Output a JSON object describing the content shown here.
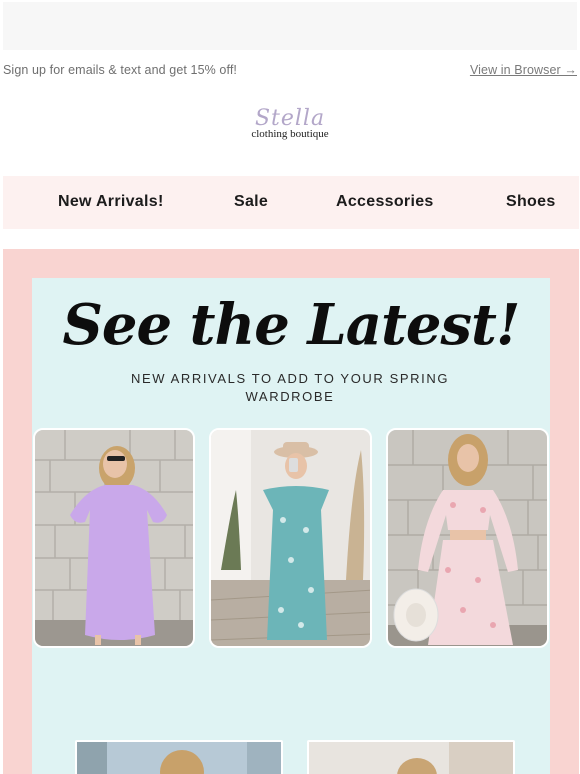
{
  "preheader": {
    "signup_text": "Sign up for emails & text and get 15% off!",
    "view_in_browser": "View in Browser →"
  },
  "logo": {
    "script_text": "Stella",
    "subtitle": "clothing boutique"
  },
  "nav": {
    "items": [
      {
        "label": "New Arrivals!"
      },
      {
        "label": "Sale"
      },
      {
        "label": "Accessories"
      },
      {
        "label": "Shoes"
      }
    ]
  },
  "hero": {
    "headline": "See the Latest!",
    "subheadline": "NEW ARRIVALS TO ADD TO YOUR SPRING WARDROBE"
  },
  "colors": {
    "nav_bg": "#fdf1f0",
    "hero_outer_bg": "#f9d4d1",
    "hero_inner_bg": "#dff3f3",
    "logo_accent": "#b3a7c9"
  }
}
